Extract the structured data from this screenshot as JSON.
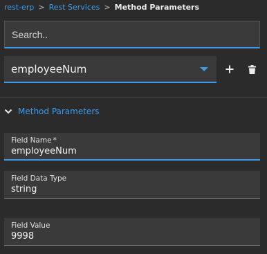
{
  "breadcrumb": {
    "items": [
      "rest-erp",
      "Rest Services"
    ],
    "separator": ">",
    "current": "Method Parameters"
  },
  "search": {
    "placeholder": "Search..",
    "value": ""
  },
  "parameter_select": {
    "selected": "employeeNum"
  },
  "actions": {
    "add_icon": "plus-icon",
    "delete_icon": "trash-icon"
  },
  "section": {
    "title": "Method Parameters",
    "expanded": true
  },
  "form": {
    "field_name": {
      "label": "Field Name",
      "required_mark": "*",
      "value": "employeeNum"
    },
    "field_data_type": {
      "label": "Field Data Type",
      "value": "string"
    },
    "field_value": {
      "label": "Field Value",
      "value": "9998"
    }
  },
  "colors": {
    "accent": "#3d9be9",
    "background": "#2b2b2b",
    "field_bg": "#3a3a3a"
  }
}
